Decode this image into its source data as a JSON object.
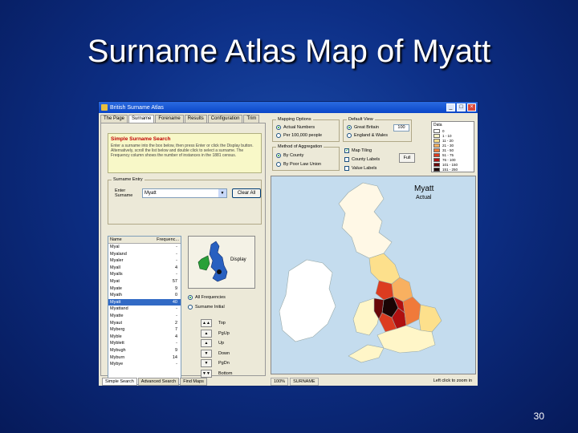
{
  "slide": {
    "title": "Surname Atlas Map of Myatt",
    "page_number": "30"
  },
  "window": {
    "title": "British Surname Atlas",
    "controls": [
      "_",
      "□",
      "×"
    ]
  },
  "tabs": [
    "The Page",
    "Surname",
    "Forename",
    "Results",
    "Configuration",
    "Trim"
  ],
  "active_tab": 1,
  "search": {
    "info_header": "Simple Surname Search",
    "info_text": "Enter a surname into the box below, then press Enter or click the Display button. Alternatively, scroll the list below and double click to select a surname. The Frequency column shows the number of instances in the 1881 census.",
    "group_label": "Surname Entry",
    "enter_label_1": "Enter",
    "enter_label_2": "Surname",
    "value": "Myatt",
    "clear_button": "Clear All"
  },
  "list": {
    "col_name": "Name",
    "col_freq": "Frequenc...",
    "rows": [
      {
        "name": "Myal",
        "freq": "-"
      },
      {
        "name": "Myaland",
        "freq": "-"
      },
      {
        "name": "Myaler",
        "freq": "-"
      },
      {
        "name": "Myall",
        "freq": "4"
      },
      {
        "name": "Myalls",
        "freq": "-"
      },
      {
        "name": "Myat",
        "freq": "57"
      },
      {
        "name": "Myate",
        "freq": "9"
      },
      {
        "name": "Myath",
        "freq": "0"
      },
      {
        "name": "Myatt",
        "freq": "40",
        "selected": true
      },
      {
        "name": "Myattand",
        "freq": "-"
      },
      {
        "name": "Myatte",
        "freq": "-"
      },
      {
        "name": "Myaut",
        "freq": "2"
      },
      {
        "name": "Myberg",
        "freq": "7"
      },
      {
        "name": "Myble",
        "freq": "4"
      },
      {
        "name": "Myblett",
        "freq": "-"
      },
      {
        "name": "Mybugh",
        "freq": "9"
      },
      {
        "name": "Myburn",
        "freq": "14"
      },
      {
        "name": "Mybye",
        "freq": "-"
      }
    ]
  },
  "thumbnail": {
    "display_label": "Display"
  },
  "options": {
    "radio_1": "All Frequencies",
    "radio_2": "Surname Initial"
  },
  "nav": [
    {
      "icon": "▲▲",
      "label": "Top"
    },
    {
      "icon": "▲",
      "label": "PgUp"
    },
    {
      "icon": "▲",
      "label": "Up"
    },
    {
      "icon": "▼",
      "label": "Down"
    },
    {
      "icon": "▼",
      "label": "PgDn"
    },
    {
      "icon": "▼▼",
      "label": "Bottom"
    }
  ],
  "bottom_tabs": [
    "Simple Search",
    "Advanced Search",
    "Find Maps"
  ],
  "mapping": {
    "group_label": "Mapping Options",
    "opt_1": "Actual Numbers",
    "opt_2": "Per 100,000 people",
    "default_label": "Default View",
    "view_1": "Great Britain",
    "view_2": "England & Wales",
    "view_value": "100",
    "agg_label": "Method of Aggregation",
    "agg_1": "By County",
    "agg_2": "By Poor Law Union",
    "chk_1": "Map Tiling",
    "chk_2": "County Labels",
    "chk_3": "Value Labels",
    "side_btn": "Full"
  },
  "legend": {
    "header": "Data",
    "rows": [
      {
        "label": "0",
        "color": "#ffffff"
      },
      {
        "label": "1 - 10",
        "color": "#fff6c8"
      },
      {
        "label": "11 - 20",
        "color": "#fde08c"
      },
      {
        "label": "21 - 30",
        "color": "#f8b060"
      },
      {
        "label": "31 - 50",
        "color": "#f07a3a"
      },
      {
        "label": "51 - 75",
        "color": "#dc3c20"
      },
      {
        "label": "76 - 100",
        "color": "#b01010"
      },
      {
        "label": "101 - 150",
        "color": "#6a0808"
      },
      {
        "label": "151 - 250",
        "color": "#1a0404"
      }
    ]
  },
  "map": {
    "name": "Myatt",
    "subtitle": "Actual",
    "colors": {
      "sea": "#c4dcee",
      "land": "#ffffff",
      "ireland": "#ffffff"
    }
  },
  "status": {
    "zoom": "100%",
    "field": "SURNAME",
    "hint": "Left click to zoom in"
  }
}
